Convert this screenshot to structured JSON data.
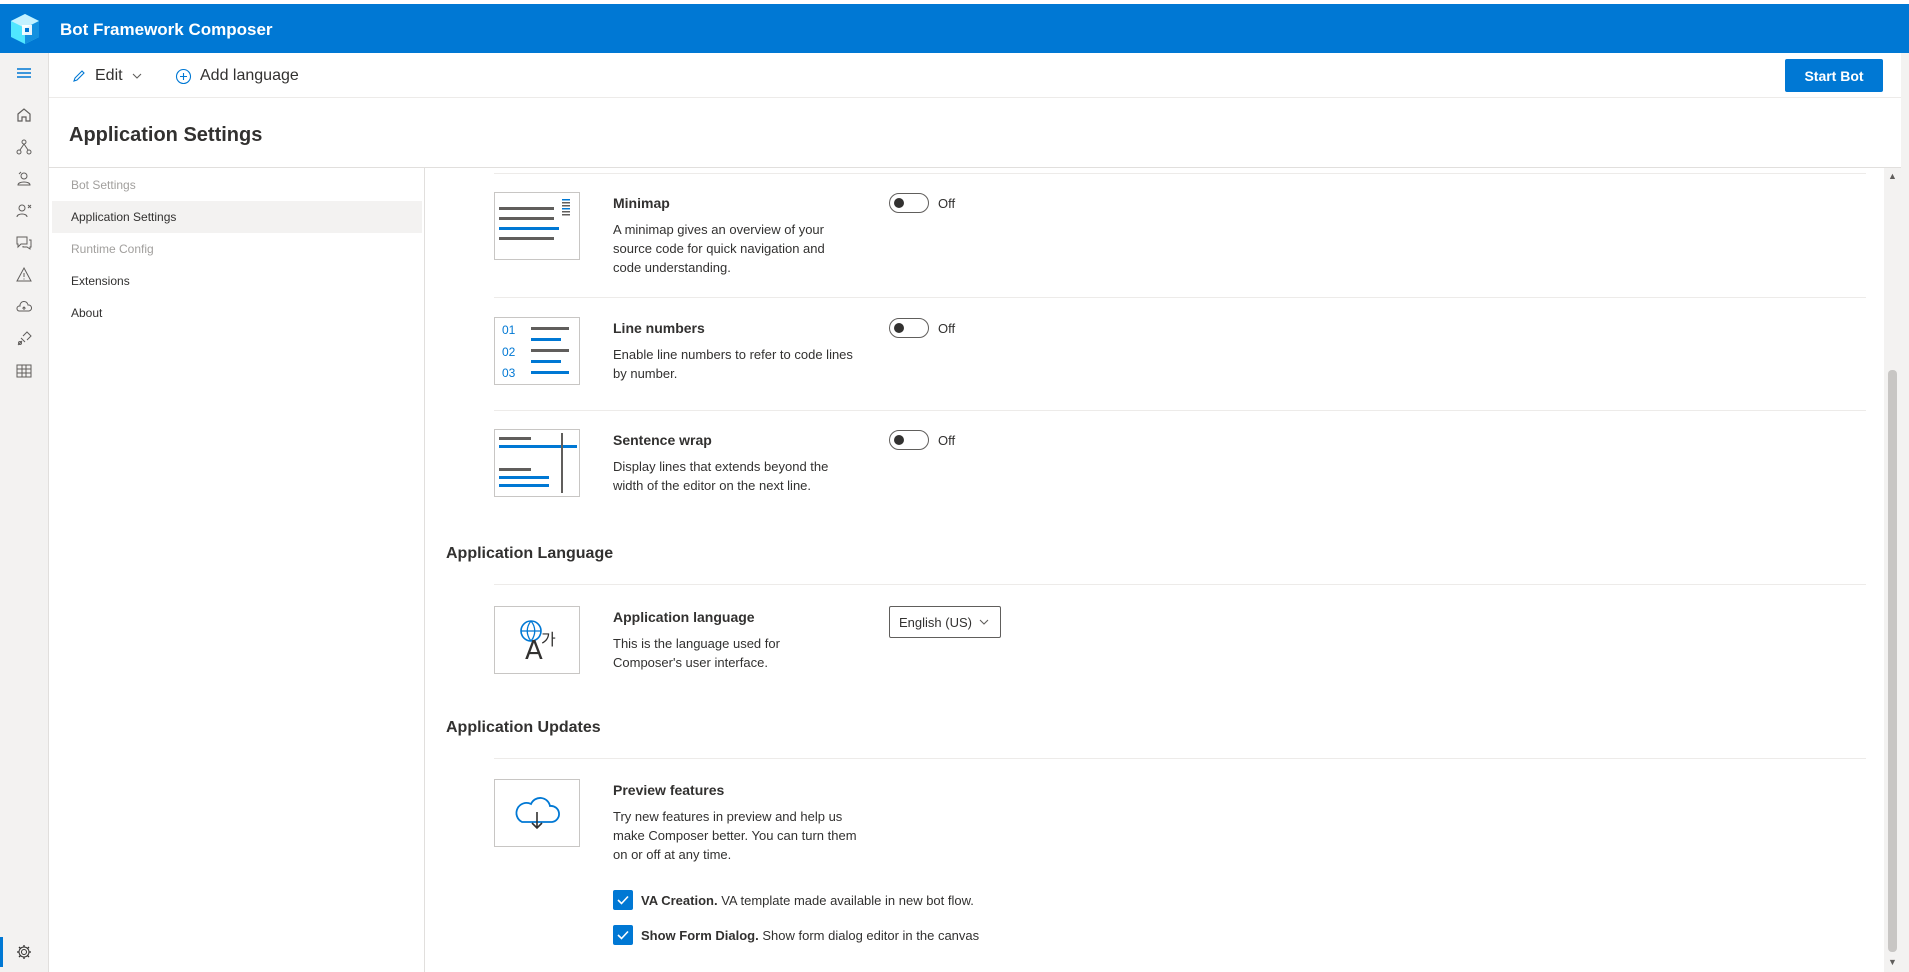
{
  "app": {
    "title": "Bot Framework Composer"
  },
  "toolbar": {
    "edit_label": "Edit",
    "add_language_label": "Add language",
    "start_bot_label": "Start Bot"
  },
  "page": {
    "title": "Application Settings"
  },
  "settings_nav": {
    "items": [
      {
        "label": "Bot Settings",
        "state": "disabled"
      },
      {
        "label": "Application Settings",
        "state": "active"
      },
      {
        "label": "Runtime Config",
        "state": "disabled"
      },
      {
        "label": "Extensions",
        "state": "normal"
      },
      {
        "label": "About",
        "state": "normal"
      }
    ]
  },
  "left_nav": {
    "icons": [
      "menu-icon",
      "home-icon",
      "design-icon",
      "bot-responses-icon",
      "user-input-icon",
      "qna-icon",
      "diagnostics-icon",
      "publish-icon",
      "packages-icon",
      "skills-icon",
      "settings-icon"
    ]
  },
  "editor_settings": {
    "minimap": {
      "title": "Minimap",
      "description": "A minimap gives an overview of your source code for quick navigation and code understanding.",
      "state": "Off"
    },
    "line_numbers": {
      "title": "Line numbers",
      "description": "Enable line numbers to refer to code lines by number.",
      "state": "Off",
      "thumb_numbers": [
        "01",
        "02",
        "03"
      ]
    },
    "sentence_wrap": {
      "title": "Sentence wrap",
      "description": "Display lines that extends beyond the width of the editor on the next line.",
      "state": "Off"
    }
  },
  "application_language": {
    "heading": "Application Language",
    "title": "Application language",
    "description": "This is the language used for Composer's user interface.",
    "selected": "English (US)"
  },
  "application_updates": {
    "heading": "Application Updates",
    "title": "Preview features",
    "description": "Try new features in preview and help us make Composer better. You can turn them on or off at any time.",
    "features": [
      {
        "name": "VA Creation.",
        "description": "VA template made available in new bot flow.",
        "checked": true
      },
      {
        "name": "Show Form Dialog.",
        "description": "Show form dialog editor in the canvas",
        "checked": true
      }
    ]
  },
  "colors": {
    "accent": "#0078d4",
    "nav_bg": "#f3f2f1",
    "text": "#323130"
  }
}
